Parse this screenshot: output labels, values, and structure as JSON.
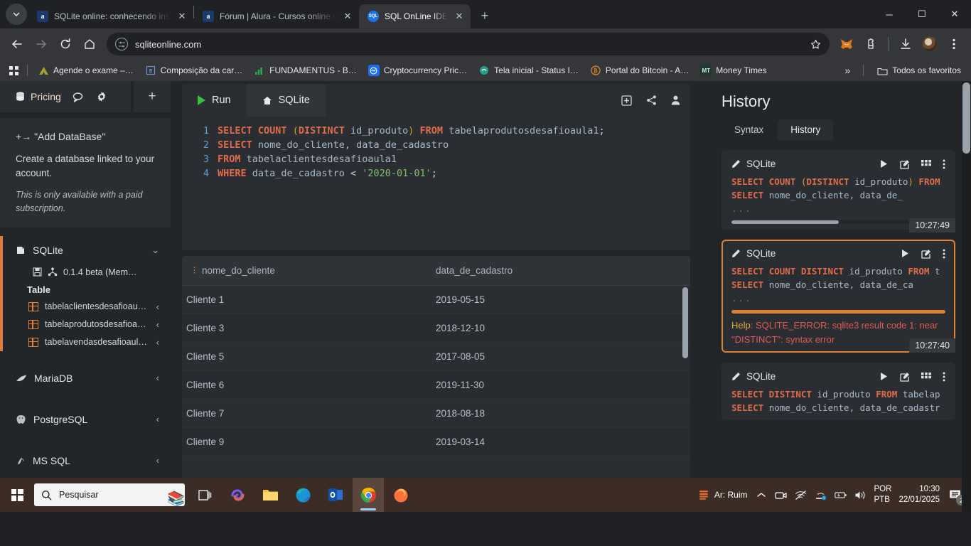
{
  "browser": {
    "tabs": [
      {
        "title": "SQLite online: conhecendo instr",
        "favicon": "alura-icon",
        "active": false
      },
      {
        "title": "Fórum | Alura - Cursos online de",
        "favicon": "alura-icon",
        "active": false
      },
      {
        "title": "SQL OnLine IDE",
        "favicon": "sql-icon",
        "active": true
      }
    ],
    "new_tab_label": "+",
    "close_label": "✕",
    "window_controls": {
      "minimize": "─",
      "maximize": "☐",
      "close": "✕"
    },
    "url": "sqliteonline.com",
    "nav": {
      "back": "←",
      "forward": "→",
      "reload": "⟳",
      "home": "⌂"
    },
    "bookmarks": [
      {
        "label": "Agende o exame –…",
        "icon": "alura-mark"
      },
      {
        "label": "Composição da car…",
        "icon": "bracket-icon"
      },
      {
        "label": "FUNDAMENTUS - B…",
        "icon": "bars-icon"
      },
      {
        "label": "Cryptocurrency Pric…",
        "icon": "coinmarketcap-icon"
      },
      {
        "label": "Tela inicial - Status I…",
        "icon": "status-icon"
      },
      {
        "label": "Portal do Bitcoin - A…",
        "icon": "bitcoin-icon"
      },
      {
        "label": "Money Times",
        "icon": "mt-icon"
      }
    ],
    "bookmarks_overflow": "»",
    "all_bookmarks": "Todos os favoritos"
  },
  "sidebar": {
    "pricing_label": "Pricing",
    "plus_label": "+",
    "add_db": {
      "title": "+→ \"Add DataBase\"",
      "description": "Create a database linked to your account.",
      "note": "This is only available with a paid subscription."
    },
    "databases": [
      {
        "name": "SQLite",
        "chevron": "⌄",
        "active": true
      },
      {
        "name": "MariaDB",
        "chevron": "‹",
        "active": false
      },
      {
        "name": "PostgreSQL",
        "chevron": "‹",
        "active": false
      },
      {
        "name": "MS SQL",
        "chevron": "‹",
        "active": false
      }
    ],
    "sqlite": {
      "version": "0.1.4 beta (Mem…",
      "table_header": "Table",
      "tables": [
        {
          "name": "tabelaclientesdesafioau…",
          "chevron": "‹"
        },
        {
          "name": "tabelaprodutosdesafioa…",
          "chevron": "‹"
        },
        {
          "name": "tabelavendasdesafioaul…",
          "chevron": "‹"
        }
      ]
    }
  },
  "editor": {
    "run_label": "Run",
    "engine_label": "SQLite",
    "actions": {
      "add": "add-icon",
      "share": "share-icon",
      "user": "user-icon"
    },
    "lines": [
      {
        "num": "1",
        "tokens": [
          {
            "t": "kw",
            "v": "SELECT "
          },
          {
            "t": "kw",
            "v": "COUNT "
          },
          {
            "t": "paren",
            "v": "("
          },
          {
            "t": "kw",
            "v": "DISTINCT "
          },
          {
            "t": "id",
            "v": "id_produto"
          },
          {
            "t": "paren",
            "v": ")"
          },
          {
            "t": "plain",
            "v": " "
          },
          {
            "t": "kw",
            "v": "FROM "
          },
          {
            "t": "id",
            "v": "tabelaprodutosdesafioaula1"
          },
          {
            "t": "plain",
            "v": ";"
          }
        ]
      },
      {
        "num": "2",
        "tokens": [
          {
            "t": "kw",
            "v": "SELECT "
          },
          {
            "t": "id",
            "v": "nome_do_cliente, data_de_cadastro"
          }
        ]
      },
      {
        "num": "3",
        "tokens": [
          {
            "t": "kw",
            "v": "FROM "
          },
          {
            "t": "id",
            "v": "tabelaclientesdesafioaula1"
          }
        ]
      },
      {
        "num": "4",
        "tokens": [
          {
            "t": "kw",
            "v": "WHERE "
          },
          {
            "t": "id",
            "v": "data_de_cadastro "
          },
          {
            "t": "op",
            "v": "< "
          },
          {
            "t": "str",
            "v": "'2020-01-01'"
          },
          {
            "t": "plain",
            "v": ";"
          }
        ]
      }
    ]
  },
  "results": {
    "columns": [
      "nome_do_cliente",
      "data_de_cadastro"
    ],
    "rows": [
      [
        "Cliente 1",
        "2019-05-15"
      ],
      [
        "Cliente 3",
        "2018-12-10"
      ],
      [
        "Cliente 5",
        "2017-08-05"
      ],
      [
        "Cliente 6",
        "2019-11-30"
      ],
      [
        "Cliente 7",
        "2018-08-18"
      ],
      [
        "Cliente 9",
        "2019-03-14"
      ]
    ],
    "cursor_artifact": "2",
    "tools": [
      "download-icon",
      "table-icon",
      "chart-icon",
      "book-icon",
      "menu-icon"
    ]
  },
  "history": {
    "title": "History",
    "tabs": [
      {
        "label": "Syntax",
        "selected": false
      },
      {
        "label": "History",
        "selected": true
      }
    ],
    "cards": [
      {
        "engine": "SQLite",
        "selected": false,
        "lines": [
          [
            {
              "t": "kw",
              "v": "SELECT "
            },
            {
              "t": "kw",
              "v": "COUNT "
            },
            {
              "t": "paren",
              "v": "("
            },
            {
              "t": "kw",
              "v": "DISTINCT "
            },
            {
              "t": "id",
              "v": "id_produto"
            },
            {
              "t": "paren",
              "v": ")"
            },
            {
              "t": "plain",
              "v": " "
            },
            {
              "t": "kw",
              "v": "FROM"
            }
          ],
          [
            {
              "t": "kw",
              "v": "SELECT "
            },
            {
              "t": "id",
              "v": "nome_do_cliente, data_de_"
            }
          ]
        ],
        "ellipsis": "...",
        "bar_pct": 50,
        "error": null,
        "time": "10:27:49",
        "actions": [
          "run-icon",
          "edit-icon",
          "grid-icon",
          "more-icon"
        ]
      },
      {
        "engine": "SQLite",
        "selected": true,
        "lines": [
          [
            {
              "t": "kw",
              "v": "SELECT "
            },
            {
              "t": "kw",
              "v": "COUNT "
            },
            {
              "t": "kw",
              "v": "DISTINCT "
            },
            {
              "t": "id",
              "v": "id_produto "
            },
            {
              "t": "kw",
              "v": "FROM "
            },
            {
              "t": "id",
              "v": "t"
            }
          ],
          [
            {
              "t": "kw",
              "v": "SELECT "
            },
            {
              "t": "id",
              "v": "nome_do_cliente, data_de_ca"
            }
          ]
        ],
        "ellipsis": "...",
        "bar_pct": 60,
        "error": {
          "label": "Help",
          "message": ": SQLITE_ERROR: sqlite3 result code 1: near \"DISTINCT\": syntax error"
        },
        "time": "10:27:40",
        "actions": [
          "run-icon",
          "edit-icon",
          "more-icon"
        ]
      },
      {
        "engine": "SQLite",
        "selected": false,
        "lines": [
          [
            {
              "t": "kw",
              "v": "SELECT "
            },
            {
              "t": "kw",
              "v": "DISTINCT "
            },
            {
              "t": "id",
              "v": "id_produto "
            },
            {
              "t": "kw",
              "v": "FROM "
            },
            {
              "t": "id",
              "v": "tabelap"
            }
          ],
          [
            {
              "t": "kw",
              "v": "SELECT "
            },
            {
              "t": "id",
              "v": "nome_do_cliente, data_de_cadastr"
            }
          ]
        ],
        "ellipsis": "",
        "bar_pct": 0,
        "error": null,
        "time": "",
        "actions": [
          "run-icon",
          "edit-icon",
          "grid-icon",
          "more-icon"
        ]
      }
    ]
  },
  "taskbar": {
    "search_placeholder": "Pesquisar",
    "apps": [
      "task-view-icon",
      "copilot-icon",
      "file-explorer-icon",
      "edge-icon",
      "outlook-icon",
      "chrome-icon",
      "firefox-icon"
    ],
    "weather": "Ar: Ruim",
    "lang_top": "POR",
    "lang_bottom": "PTB",
    "time": "10:30",
    "date": "22/01/2025",
    "notification_count": "2"
  },
  "colors": {
    "accent_orange": "#e0822f",
    "keyword": "#e06c4a",
    "error_red": "#e05a5a",
    "string_green": "#7fbf6a"
  }
}
